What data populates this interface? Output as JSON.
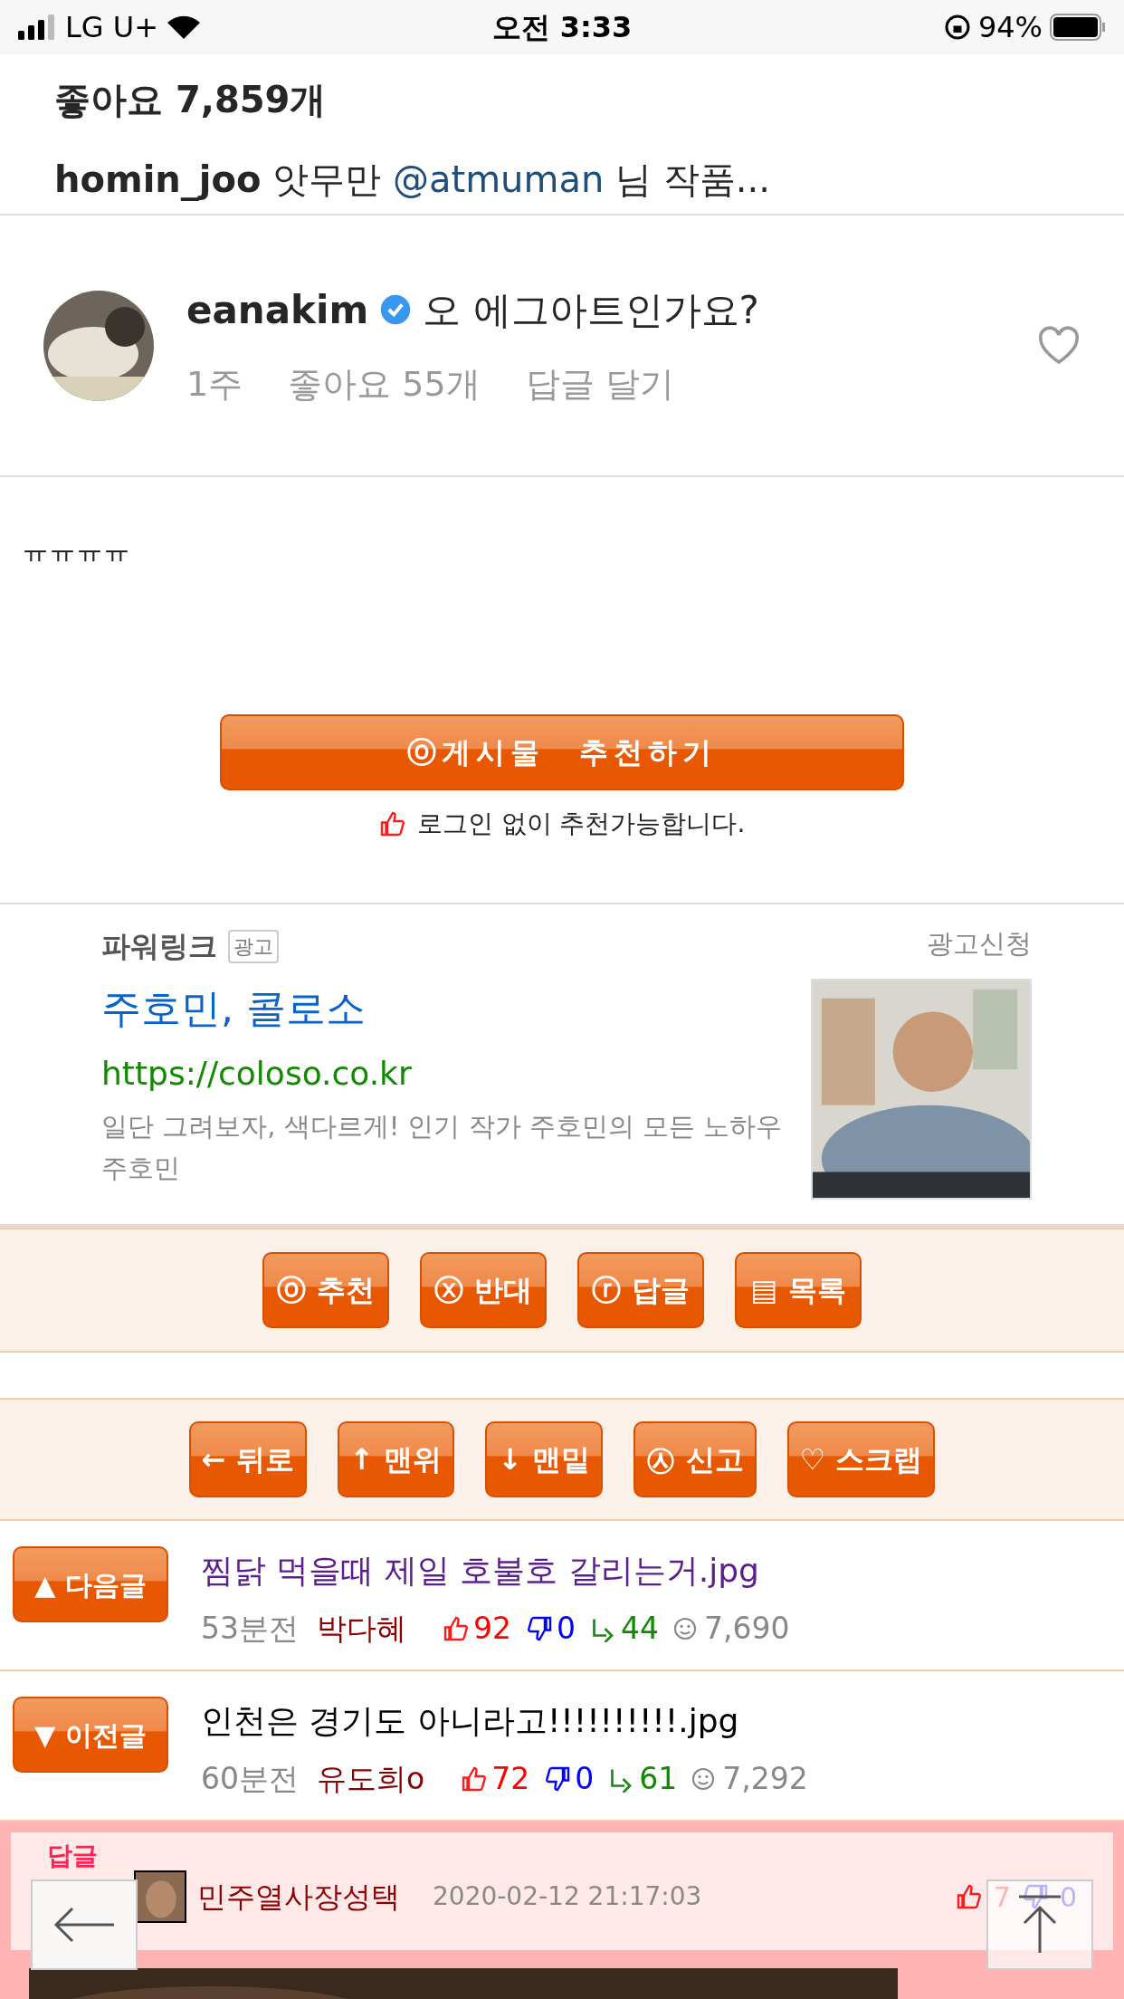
{
  "status_bar": {
    "carrier": "LG U+",
    "time": "오전 3:33",
    "battery": "94%"
  },
  "embedded_post": {
    "likes": "좋아요 7,859개",
    "caption_user": "homin_joo",
    "caption_text": "앗무만",
    "caption_mention": "@atmuman",
    "caption_tail": "님 작품...",
    "comment": {
      "user": "eanakim",
      "verified": true,
      "text": "오 에그아트인가요?",
      "time": "1주",
      "likes": "좋아요 55개",
      "reply": "답글 달기",
      "liked": false
    }
  },
  "post_body": "ㅠㅠㅠㅠ",
  "recommend_button": "ⓞ게시물　추천하기",
  "recommend_note": "로그인 없이 추천가능합니다.",
  "ad": {
    "label": "파워링크",
    "badge": "광고",
    "apply": "광고신청",
    "title": "주호민, 콜로소",
    "url": "https://coloso.co.kr",
    "description": "일단 그려보자, 색다르게! 인기 작가 주호민의 모든 노하우 주호민"
  },
  "action_buttons": [
    "ⓞ 추천",
    "ⓧ 반대",
    "ⓡ 답글",
    "▤ 목록"
  ],
  "nav_buttons": [
    "← 뒤로",
    "↑ 맨위",
    "↓ 맨밑",
    "㉦ 신고",
    "♡ 스크랩"
  ],
  "adjacent_posts": [
    {
      "button": "▲ 다음글",
      "title": "찜닭 먹을때 제일 호불호 갈리는거.jpg",
      "visited": true,
      "time": "53분전",
      "author": "박다혜",
      "up": "92",
      "down": "0",
      "replies": "44",
      "views": "7,690"
    },
    {
      "button": "▼ 이전글",
      "title": "인천은 경기도 아니라고!!!!!!!!!!.jpg",
      "visited": false,
      "time": "60분전",
      "author": "유도희o",
      "up": "72",
      "down": "0",
      "replies": "61",
      "views": "7,292"
    }
  ],
  "best_reply": {
    "badge_top": "답글",
    "user": "민주열사장성택",
    "date": "2020-02-12 21:17:03",
    "up": "7",
    "down": "0"
  }
}
